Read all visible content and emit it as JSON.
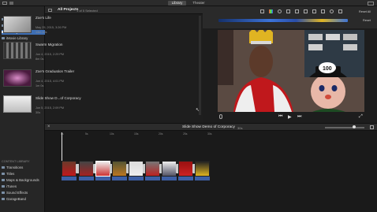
{
  "topbar": {
    "library_label": "Library",
    "theater_label": "Theater"
  },
  "sidebar": {
    "items": [
      {
        "label": "Photos Library"
      },
      {
        "label": "All Events"
      },
      {
        "label": "All Projects"
      },
      {
        "label": "iMovie Library"
      },
      {
        "label": "2015"
      },
      {
        "label": "4-28-15"
      }
    ],
    "content_library_heading": "CONTENT LIBRARY",
    "content_items": [
      {
        "label": "Transitions"
      },
      {
        "label": "Titles"
      },
      {
        "label": "Maps & Backgrounds"
      },
      {
        "label": "iTunes"
      },
      {
        "label": "Sound Effects"
      },
      {
        "label": "GarageBand"
      }
    ]
  },
  "browser": {
    "header_title": "All Projects",
    "selection_text": "1 of 5 Selected",
    "projects": [
      {
        "title": "Zoe's Life",
        "date": "May 25, 2015, 3:26 PM",
        "duration": "13m 10s"
      },
      {
        "title": "Swarm Migration",
        "date": "Jun 4, 2015, 2:29 PM",
        "duration": "8m 0s"
      },
      {
        "title": "Zoe's Graduation Trailer",
        "date": "Jun 4, 2015, 4:01 PM",
        "duration": "1m 0s"
      },
      {
        "title": "Slide Show D...of Corporacy",
        "date": "Jun 5, 2015, 2:09 PM",
        "duration": "30s"
      }
    ]
  },
  "viewer": {
    "reset_label": "Reset All",
    "reset2_label": "Reset"
  },
  "timeline": {
    "title": "Slide Show Demo of Corporacy",
    "duration": "30s",
    "ruler": [
      "0s",
      "5s",
      "10s",
      "15s",
      "20s",
      "25s",
      "30s"
    ]
  },
  "colors": {
    "selection": "#3e6fb5",
    "audio_track": "#3d5fa5",
    "accent_yellow": "#e0b422"
  }
}
